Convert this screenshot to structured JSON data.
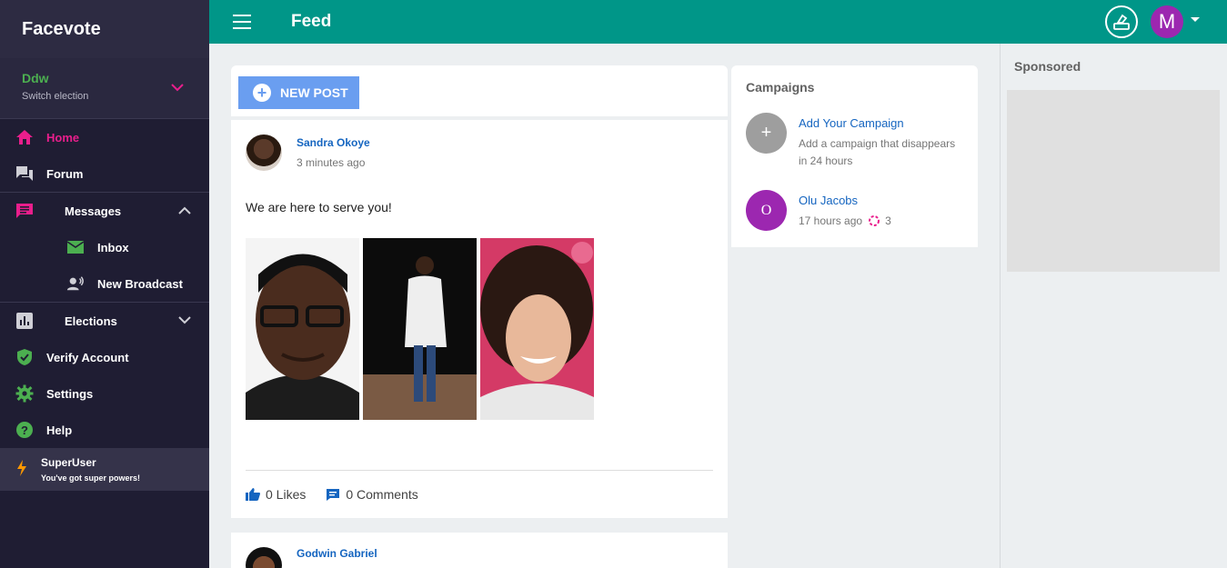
{
  "brand": "Facevote",
  "election": {
    "name": "Ddw",
    "switch_label": "Switch election"
  },
  "nav": {
    "home": "Home",
    "forum": "Forum",
    "messages": "Messages",
    "inbox": "Inbox",
    "new_broadcast": "New Broadcast",
    "elections": "Elections",
    "verify": "Verify Account",
    "settings": "Settings",
    "help": "Help"
  },
  "superuser": {
    "title": "SuperUser",
    "subtitle": "You've got super powers!"
  },
  "topbar": {
    "title": "Feed",
    "avatar_letter": "M"
  },
  "new_post_label": "NEW POST",
  "posts": [
    {
      "author": "Sandra Okoye",
      "time": "3 minutes ago",
      "text": "We are here to serve you!",
      "likes": "0 Likes",
      "comments": "0 Comments"
    },
    {
      "author": "Godwin Gabriel"
    }
  ],
  "campaigns": {
    "title": "Campaigns",
    "add": {
      "name": "Add Your Campaign",
      "desc": "Add a campaign that disappears in 24 hours"
    },
    "items": [
      {
        "initial": "O",
        "name": "Olu Jacobs",
        "time": "17 hours ago",
        "count": "3"
      }
    ]
  },
  "sponsored_title": "Sponsored",
  "colors": {
    "topbar": "#009688",
    "sidebar": "#1f1d33",
    "active": "#e91e8c",
    "link": "#1565c0",
    "avatar": "#9c27b0"
  }
}
